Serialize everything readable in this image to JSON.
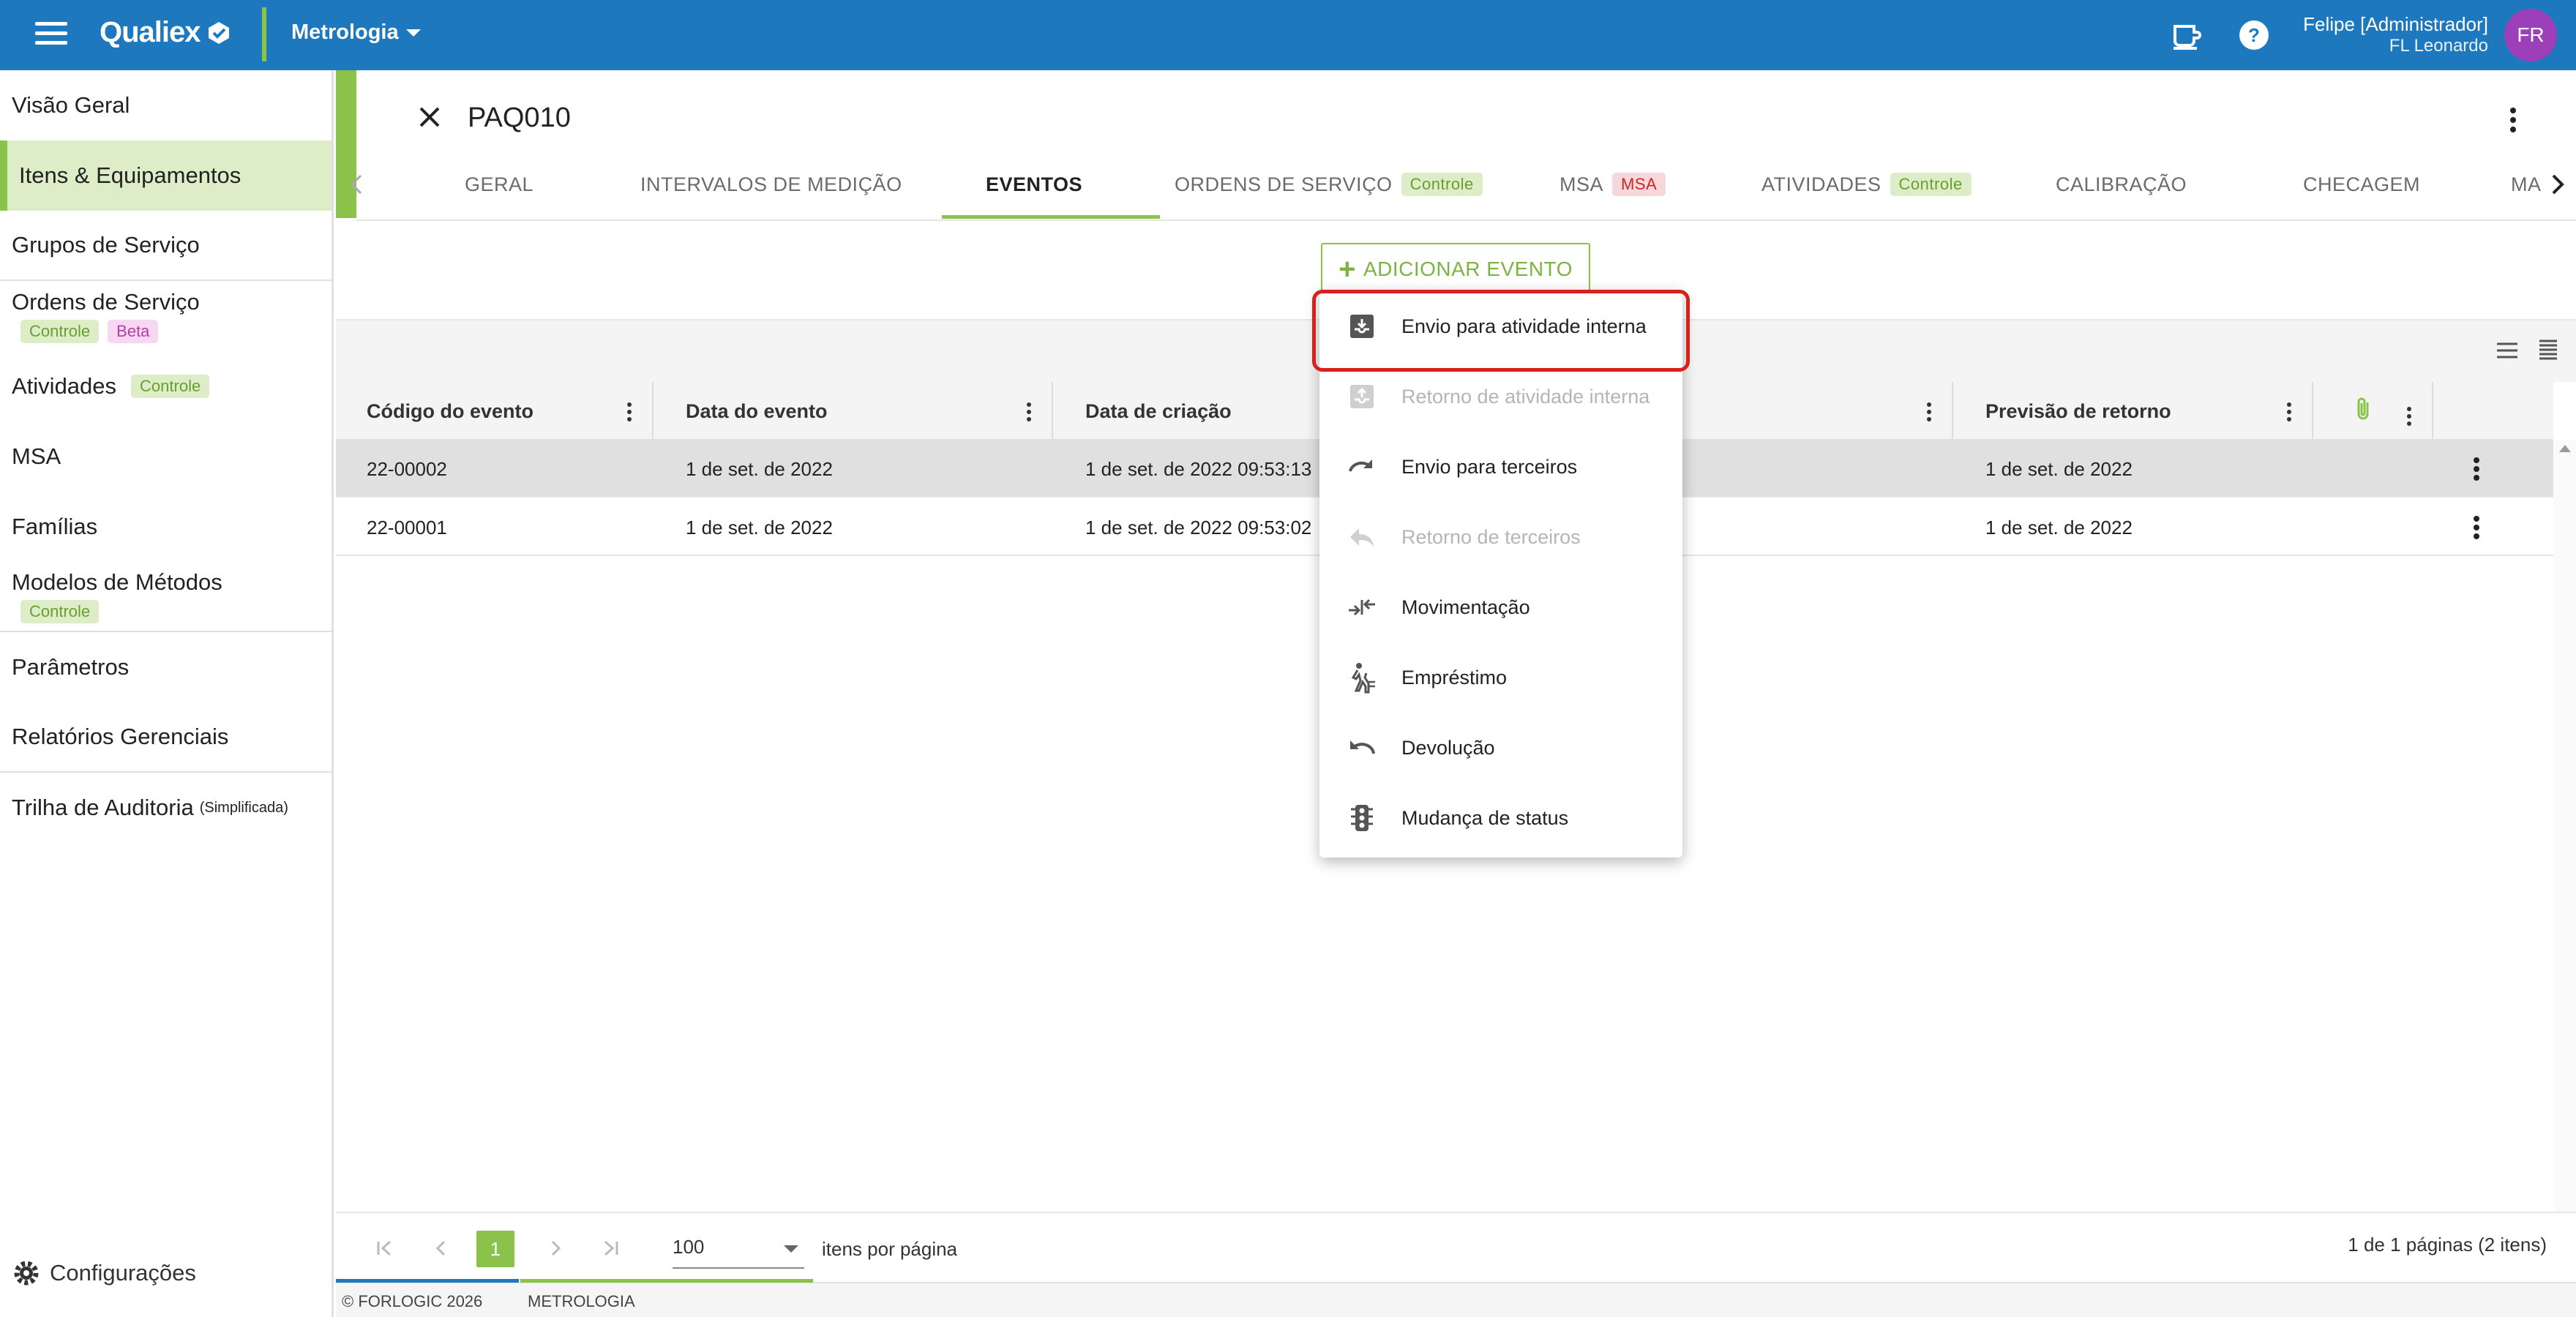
{
  "topbar": {
    "brand": "Qualiex",
    "module": "Metrologia",
    "user_name": "Felipe [Administrador]",
    "user_company": "FL Leonardo",
    "avatar_initials": "FR",
    "colors": {
      "primary": "#1d78bd",
      "accent": "#8bc34a",
      "avatar": "#9c3fb8"
    }
  },
  "sidebar": {
    "items": [
      {
        "label": "Visão Geral"
      },
      {
        "label": "Itens & Equipamentos"
      },
      {
        "label": "Grupos de Serviço"
      },
      {
        "label": "Ordens de Serviço",
        "badges": [
          "Controle",
          "Beta"
        ]
      },
      {
        "label": "Atividades",
        "badges": [
          "Controle"
        ]
      },
      {
        "label": "MSA"
      },
      {
        "label": "Famílias"
      },
      {
        "label": "Modelos de Métodos",
        "badges": [
          "Controle"
        ]
      },
      {
        "label": "Parâmetros"
      },
      {
        "label": "Relatórios Gerenciais"
      },
      {
        "label": "Trilha de Auditoria",
        "suffix": "(Simplificada)"
      }
    ],
    "config_label": "Configurações"
  },
  "header": {
    "title": "PAQ010"
  },
  "tabs": [
    {
      "label": "GERAL"
    },
    {
      "label": "INTERVALOS DE MEDIÇÃO"
    },
    {
      "label": "EVENTOS",
      "active": true
    },
    {
      "label": "ORDENS DE SERVIÇO",
      "badge": "Controle"
    },
    {
      "label": "MSA",
      "badge": "MSA"
    },
    {
      "label": "ATIVIDADES",
      "badge": "Controle"
    },
    {
      "label": "CALIBRAÇÃO"
    },
    {
      "label": "CHECAGEM"
    },
    {
      "label": "MAI"
    }
  ],
  "add_button": {
    "label": "ADICIONAR EVENTO"
  },
  "menu": {
    "items": [
      {
        "label": "Envio para atividade interna",
        "icon": "inbox-out-icon",
        "disabled": false,
        "highlighted": true
      },
      {
        "label": "Retorno de atividade interna",
        "icon": "inbox-in-icon",
        "disabled": true
      },
      {
        "label": "Envio para terceiros",
        "icon": "redo-icon",
        "disabled": false
      },
      {
        "label": "Retorno de terceiros",
        "icon": "reply-icon",
        "disabled": true
      },
      {
        "label": "Movimentação",
        "icon": "move-arrows-icon",
        "disabled": false
      },
      {
        "label": "Empréstimo",
        "icon": "person-walking-icon",
        "disabled": false
      },
      {
        "label": "Devolução",
        "icon": "undo-icon",
        "disabled": false
      },
      {
        "label": "Mudança de status",
        "icon": "traffic-light-icon",
        "disabled": false
      }
    ]
  },
  "grid": {
    "columns": [
      "Código do evento",
      "Data do evento",
      "Data de criação",
      "",
      "Previsão de retorno"
    ],
    "rows": [
      {
        "code": "22-00002",
        "event_date": "1 de set. de 2022",
        "created": "1 de set. de 2022 09:53:13",
        "return_date": "1 de set. de 2022",
        "selected": true
      },
      {
        "code": "22-00001",
        "event_date": "1 de set. de 2022",
        "created": "1 de set. de 2022 09:53:02",
        "return_date": "1 de set. de 2022",
        "selected": false
      }
    ]
  },
  "pager": {
    "current_page": "1",
    "page_size": "100",
    "page_size_label": "itens por página",
    "info": "1 de 1 páginas (2 itens)"
  },
  "footer": {
    "copyright": "© FORLOGIC 2026",
    "module": "METROLOGIA"
  }
}
